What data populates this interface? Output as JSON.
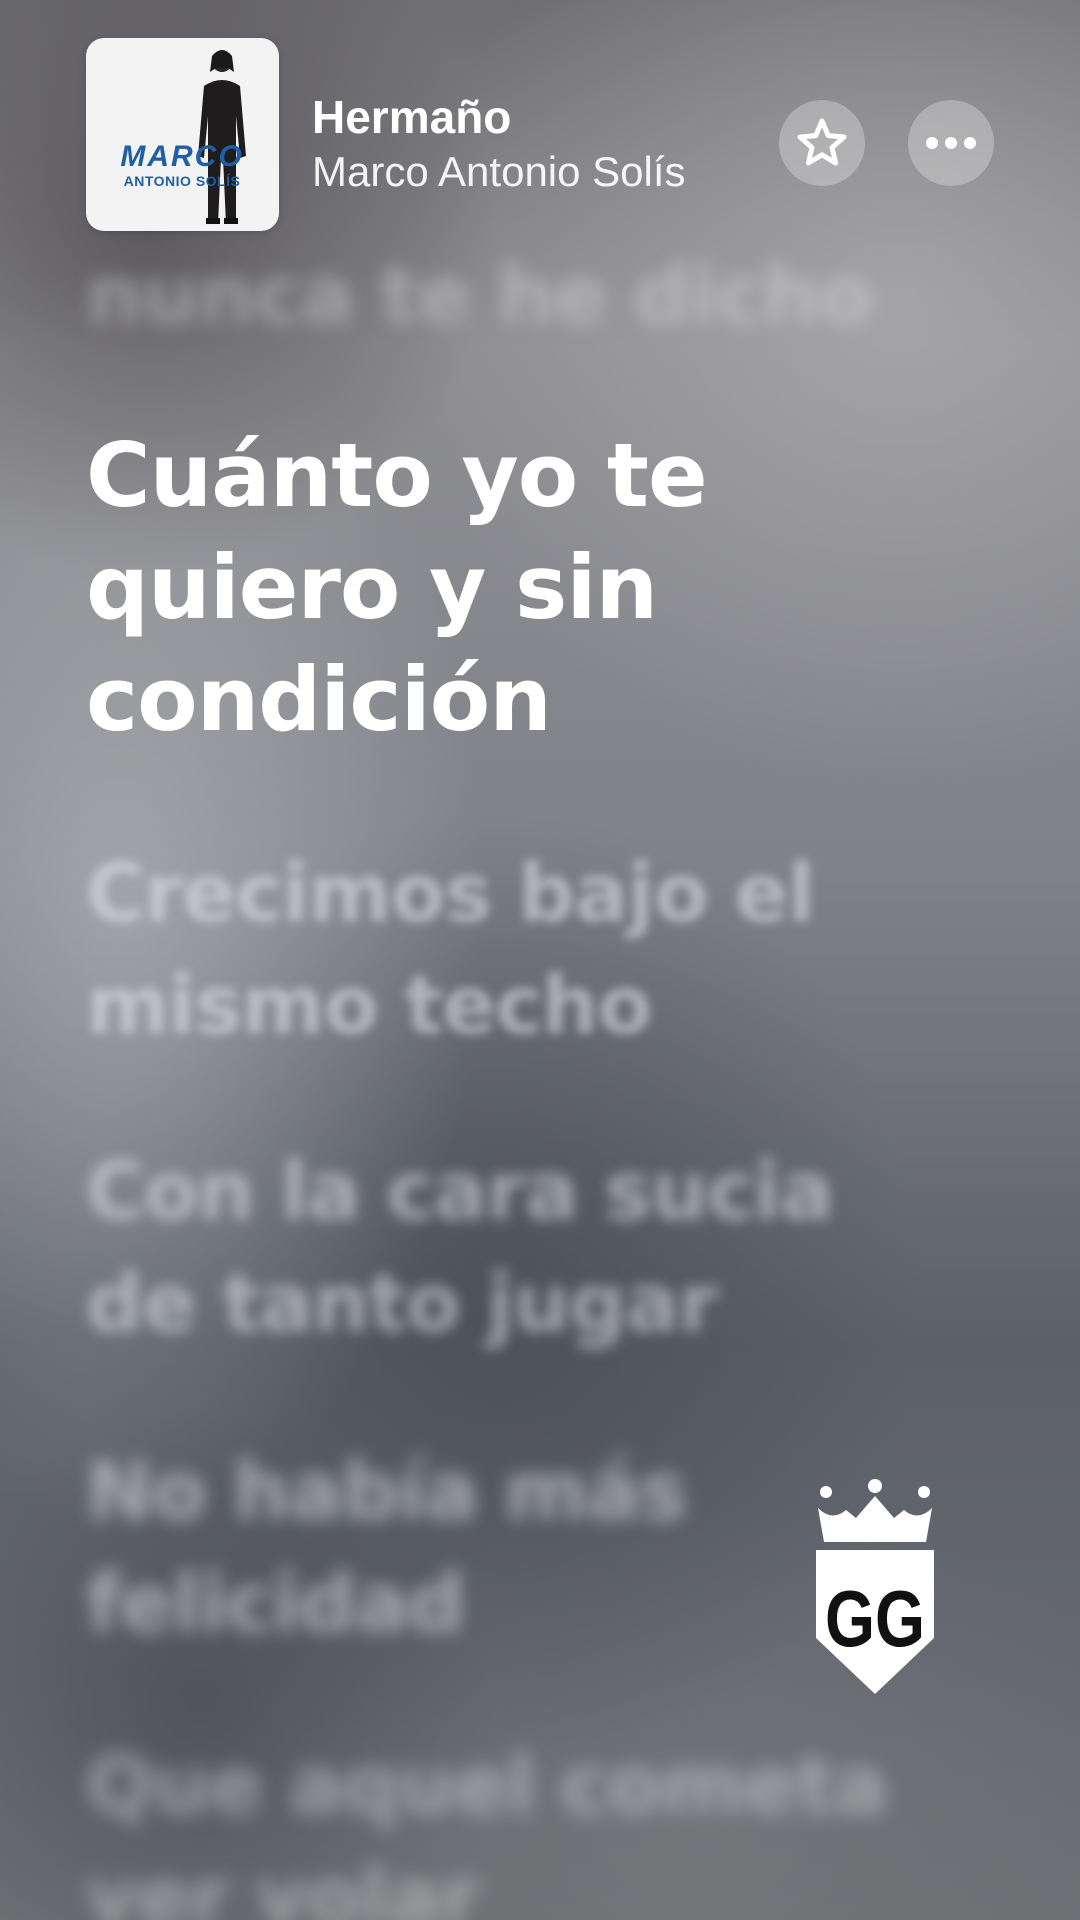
{
  "header": {
    "album_art": {
      "logo_text": "MARCO",
      "logo_subtext": "ANTONIO SOLÍS"
    },
    "title": "Hermaño",
    "artist": "Marco Antonio Solís",
    "buttons": {
      "favorite_icon": "star-icon",
      "more_icon": "ellipsis-icon"
    }
  },
  "lyrics": {
    "previous": "nunca te he dicho",
    "current": "Cuánto yo te quiero y sin condición",
    "upcoming": [
      "Crecimos bajo el mismo techo",
      "Con la cara sucia de tanto jugar",
      "No había más felicidad",
      "Que aquel cometa ver volar"
    ]
  },
  "watermark": {
    "text": "GG"
  },
  "colors": {
    "active_lyric": "#ffffff",
    "inactive_lyric": "rgba(230,232,236,0.55)",
    "album_logo_blue": "#1f5fa3"
  }
}
